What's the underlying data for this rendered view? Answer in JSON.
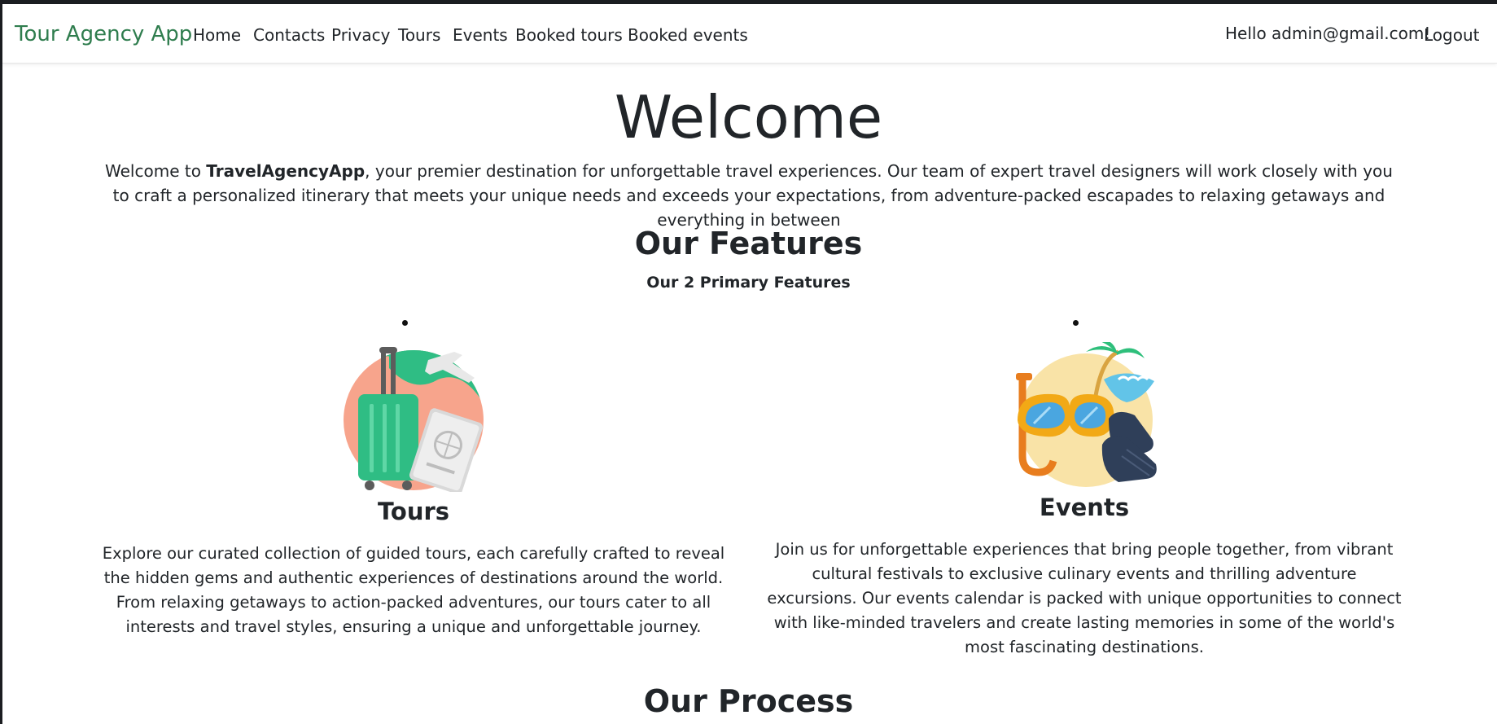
{
  "navbar": {
    "brand": "Tour Agency App",
    "links": [
      "Home",
      "Contacts",
      "Privacy",
      "Tours",
      "Events",
      "Booked tours",
      "Booked events"
    ],
    "greeting": "Hello admin@gmail.com!",
    "logout": "Logout"
  },
  "hero": {
    "title": "Welcome",
    "intro_prefix": "Welcome to ",
    "intro_brand": "TravelAgencyApp",
    "intro_rest": ", your premier destination for unforgettable travel experiences. Our team of expert travel designers will work closely with you to craft a personalized itinerary that meets your unique needs and exceeds your expectations, from adventure-packed escapades to relaxing getaways and everything in between"
  },
  "features": {
    "title": "Our Features",
    "subtitle": "Our 2 Primary Features",
    "items": [
      {
        "title": "Tours",
        "icon": "luggage-travel-icon",
        "description": "Explore our curated collection of guided tours, each carefully crafted to reveal the hidden gems and authentic experiences of destinations around the world. From relaxing getaways to action-packed adventures, our tours cater to all interests and travel styles, ensuring a unique and unforgettable journey."
      },
      {
        "title": "Events",
        "icon": "snorkel-beach-icon",
        "description": "Join us for unforgettable experiences that bring people together, from vibrant cultural festivals to exclusive culinary events and thrilling adventure excursions. Our events calendar is packed with unique opportunities to connect with like-minded travelers and create lasting memories in some of the world's most fascinating destinations."
      }
    ]
  },
  "process": {
    "title": "Our Process"
  },
  "colors": {
    "brand": "#2f7d4e",
    "text": "#212529"
  }
}
